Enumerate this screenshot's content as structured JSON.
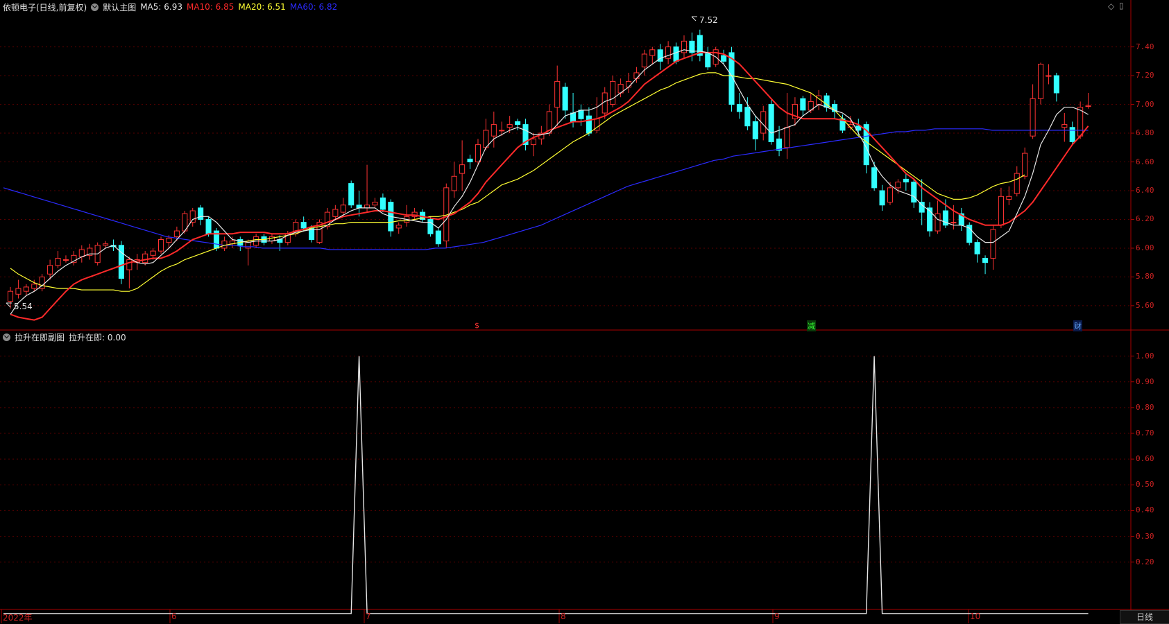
{
  "header": {
    "title": "依顿电子(日线,前复权)",
    "main_chart_name": "默认主图",
    "ma": [
      {
        "label": "MA5: 6.93",
        "color": "#e6e6e6"
      },
      {
        "label": "MA10: 6.85",
        "color": "#ff2a2a"
      },
      {
        "label": "MA20: 6.51",
        "color": "#ffff33"
      },
      {
        "label": "MA60: 6.82",
        "color": "#2b2bff"
      }
    ]
  },
  "sub_header": {
    "name": "拉升在即副图",
    "value_label": "拉升在即: 0.00"
  },
  "markers": {
    "high": "7.52",
    "low": "5.54",
    "m1": "$",
    "m2": "减",
    "m3": "财"
  },
  "price_axis": [
    "7.40",
    "7.20",
    "7.00",
    "6.80",
    "6.60",
    "6.40",
    "6.20",
    "6.00",
    "5.80",
    "5.60"
  ],
  "sub_axis": [
    "1.00",
    "0.90",
    "0.80",
    "0.70",
    "0.60",
    "0.50",
    "0.40",
    "0.30",
    "0.20"
  ],
  "date_axis": [
    "2022年",
    "6",
    "7",
    "8",
    "9",
    "10"
  ],
  "period_button": "日线",
  "colors": {
    "up": "#ff3333",
    "down": "#33ffff",
    "grid": "#5a0000",
    "axis": "#aa0000"
  },
  "chart_data": {
    "type": "line",
    "price_range": [
      5.45,
      7.62
    ],
    "candles": [
      [
        5.63,
        5.7,
        5.58,
        5.73
      ],
      [
        5.68,
        5.72,
        5.65,
        5.78
      ],
      [
        5.7,
        5.73,
        5.67,
        5.75
      ],
      [
        5.72,
        5.75,
        5.7,
        5.78
      ],
      [
        5.72,
        5.8,
        5.7,
        5.82
      ],
      [
        5.82,
        5.88,
        5.78,
        5.92
      ],
      [
        5.88,
        5.93,
        5.86,
        5.98
      ],
      [
        5.92,
        5.92,
        5.9,
        5.95
      ],
      [
        5.9,
        5.95,
        5.88,
        5.98
      ],
      [
        5.94,
        5.99,
        5.9,
        6.02
      ],
      [
        5.95,
        6.0,
        5.92,
        6.03
      ],
      [
        5.9,
        6.02,
        5.88,
        6.04
      ],
      [
        6.02,
        6.03,
        6.0,
        6.05
      ],
      [
        6.02,
        6.01,
        5.98,
        6.06
      ],
      [
        6.02,
        5.79,
        5.75,
        6.05
      ],
      [
        5.85,
        5.92,
        5.72,
        5.94
      ],
      [
        5.9,
        5.92,
        5.85,
        5.96
      ],
      [
        5.9,
        5.96,
        5.88,
        5.98
      ],
      [
        5.95,
        5.98,
        5.92,
        6.0
      ],
      [
        5.98,
        6.06,
        5.96,
        6.08
      ],
      [
        6.04,
        6.07,
        6.0,
        6.09
      ],
      [
        6.08,
        6.12,
        6.05,
        6.15
      ],
      [
        6.12,
        6.24,
        6.1,
        6.26
      ],
      [
        6.18,
        6.26,
        6.15,
        6.28
      ],
      [
        6.28,
        6.2,
        6.16,
        6.3
      ],
      [
        6.2,
        6.1,
        6.08,
        6.22
      ],
      [
        6.12,
        6.0,
        5.98,
        6.14
      ],
      [
        6.0,
        6.05,
        5.98,
        6.08
      ],
      [
        6.03,
        6.05,
        6.0,
        6.08
      ],
      [
        6.06,
        6.02,
        5.98,
        6.08
      ],
      [
        6.0,
        6.04,
        5.88,
        6.06
      ],
      [
        6.02,
        6.08,
        6.0,
        6.1
      ],
      [
        6.08,
        6.04,
        6.02,
        6.1
      ],
      [
        6.05,
        6.08,
        6.03,
        6.1
      ],
      [
        6.06,
        6.04,
        5.98,
        6.09
      ],
      [
        6.04,
        6.1,
        6.02,
        6.12
      ],
      [
        6.1,
        6.18,
        6.08,
        6.2
      ],
      [
        6.18,
        6.14,
        6.12,
        6.22
      ],
      [
        6.14,
        6.06,
        6.04,
        6.16
      ],
      [
        6.04,
        6.18,
        6.03,
        6.2
      ],
      [
        6.15,
        6.25,
        6.13,
        6.28
      ],
      [
        6.22,
        6.27,
        6.2,
        6.3
      ],
      [
        6.25,
        6.3,
        6.23,
        6.35
      ],
      [
        6.45,
        6.3,
        6.28,
        6.47
      ],
      [
        6.3,
        6.28,
        6.22,
        6.4
      ],
      [
        6.28,
        6.3,
        6.25,
        6.58
      ],
      [
        6.3,
        6.32,
        6.28,
        6.35
      ],
      [
        6.35,
        6.27,
        6.25,
        6.38
      ],
      [
        6.32,
        6.12,
        6.08,
        6.34
      ],
      [
        6.14,
        6.16,
        6.1,
        6.18
      ],
      [
        6.18,
        6.22,
        6.15,
        6.3
      ],
      [
        6.22,
        6.25,
        6.2,
        6.28
      ],
      [
        6.25,
        6.2,
        6.18,
        6.27
      ],
      [
        6.2,
        6.1,
        6.08,
        6.22
      ],
      [
        6.12,
        6.03,
        6.01,
        6.14
      ],
      [
        6.05,
        6.42,
        6.0,
        6.45
      ],
      [
        6.4,
        6.5,
        6.35,
        6.6
      ],
      [
        6.52,
        6.58,
        6.4,
        6.75
      ],
      [
        6.62,
        6.6,
        6.55,
        6.65
      ],
      [
        6.6,
        6.72,
        6.58,
        6.76
      ],
      [
        6.7,
        6.82,
        6.68,
        6.9
      ],
      [
        6.78,
        6.86,
        6.7,
        6.95
      ],
      [
        6.82,
        6.82,
        6.78,
        6.88
      ],
      [
        6.84,
        6.86,
        6.8,
        6.92
      ],
      [
        6.88,
        6.86,
        6.82,
        6.9
      ],
      [
        6.86,
        6.72,
        6.68,
        6.9
      ],
      [
        6.72,
        6.76,
        6.64,
        6.8
      ],
      [
        6.76,
        6.8,
        6.72,
        6.85
      ],
      [
        6.8,
        6.95,
        6.78,
        7.0
      ],
      [
        6.98,
        7.16,
        6.85,
        7.27
      ],
      [
        7.12,
        6.96,
        6.9,
        7.15
      ],
      [
        6.94,
        6.88,
        6.84,
        7.08
      ],
      [
        6.96,
        6.9,
        6.85,
        7.0
      ],
      [
        6.92,
        6.8,
        6.78,
        6.98
      ],
      [
        6.82,
        6.9,
        6.8,
        7.05
      ],
      [
        6.94,
        7.08,
        6.9,
        7.12
      ],
      [
        7.0,
        7.16,
        6.98,
        7.2
      ],
      [
        7.08,
        7.14,
        7.05,
        7.18
      ],
      [
        7.12,
        7.16,
        7.08,
        7.22
      ],
      [
        7.18,
        7.22,
        7.15,
        7.26
      ],
      [
        7.26,
        7.35,
        7.2,
        7.38
      ],
      [
        7.34,
        7.38,
        7.28,
        7.4
      ],
      [
        7.38,
        7.3,
        7.24,
        7.42
      ],
      [
        7.32,
        7.4,
        7.28,
        7.44
      ],
      [
        7.4,
        7.3,
        7.28,
        7.43
      ],
      [
        7.36,
        7.44,
        7.32,
        7.48
      ],
      [
        7.44,
        7.36,
        7.3,
        7.5
      ],
      [
        7.48,
        7.34,
        7.3,
        7.52
      ],
      [
        7.36,
        7.26,
        7.24,
        7.4
      ],
      [
        7.28,
        7.38,
        7.26,
        7.4
      ],
      [
        7.34,
        7.3,
        7.28,
        7.38
      ],
      [
        7.36,
        7.0,
        6.95,
        7.4
      ],
      [
        7.0,
        6.95,
        6.9,
        7.08
      ],
      [
        6.98,
        6.85,
        6.82,
        7.05
      ],
      [
        6.88,
        6.76,
        6.68,
        6.92
      ],
      [
        6.8,
        6.95,
        6.75,
        6.99
      ],
      [
        7.0,
        6.74,
        6.72,
        7.03
      ],
      [
        6.76,
        6.68,
        6.64,
        6.85
      ],
      [
        6.7,
        6.84,
        6.62,
        7.08
      ],
      [
        6.9,
        7.0,
        6.85,
        7.05
      ],
      [
        7.04,
        6.96,
        6.92,
        7.06
      ],
      [
        6.96,
        7.02,
        6.94,
        7.08
      ],
      [
        7.0,
        7.06,
        6.96,
        7.1
      ],
      [
        7.06,
        6.98,
        6.95,
        7.08
      ],
      [
        7.0,
        6.95,
        6.9,
        7.03
      ],
      [
        6.9,
        6.82,
        6.8,
        6.93
      ],
      [
        6.84,
        6.86,
        6.82,
        6.92
      ],
      [
        6.85,
        6.82,
        6.78,
        6.9
      ],
      [
        6.86,
        6.58,
        6.52,
        6.88
      ],
      [
        6.56,
        6.42,
        6.4,
        6.6
      ],
      [
        6.4,
        6.3,
        6.26,
        6.44
      ],
      [
        6.32,
        6.42,
        6.3,
        6.46
      ],
      [
        6.42,
        6.46,
        6.38,
        6.48
      ],
      [
        6.48,
        6.46,
        6.4,
        6.52
      ],
      [
        6.46,
        6.32,
        6.28,
        6.48
      ],
      [
        6.32,
        6.25,
        6.16,
        6.48
      ],
      [
        6.28,
        6.12,
        6.08,
        6.32
      ],
      [
        6.12,
        6.24,
        6.1,
        6.33
      ],
      [
        6.26,
        6.16,
        6.14,
        6.34
      ],
      [
        6.18,
        6.18,
        6.13,
        6.3
      ],
      [
        6.24,
        6.16,
        6.12,
        6.28
      ],
      [
        6.16,
        6.04,
        6.02,
        6.18
      ],
      [
        6.04,
        5.96,
        5.9,
        6.06
      ],
      [
        5.93,
        5.9,
        5.82,
        5.95
      ],
      [
        5.93,
        6.13,
        5.85,
        6.16
      ],
      [
        6.16,
        6.36,
        6.14,
        6.42
      ],
      [
        6.34,
        6.36,
        6.3,
        6.43
      ],
      [
        6.38,
        6.52,
        6.36,
        6.57
      ],
      [
        6.5,
        6.66,
        6.48,
        6.7
      ],
      [
        6.78,
        7.04,
        6.76,
        7.14
      ],
      [
        7.04,
        7.28,
        7.0,
        7.29
      ],
      [
        7.2,
        7.2,
        7.14,
        7.28
      ],
      [
        7.2,
        7.08,
        7.02,
        7.22
      ],
      [
        6.84,
        6.86,
        6.74,
        6.94
      ],
      [
        6.84,
        6.74,
        6.72,
        6.88
      ],
      [
        6.78,
        6.98,
        6.76,
        7.02
      ],
      [
        6.99,
        6.99,
        6.97,
        7.08
      ]
    ],
    "ma5": [
      5.54,
      5.62,
      5.67,
      5.7,
      5.74,
      5.79,
      5.84,
      5.88,
      5.91,
      5.94,
      5.96,
      5.96,
      6.0,
      6.02,
      5.97,
      5.93,
      5.9,
      5.89,
      5.9,
      5.95,
      6.0,
      6.06,
      6.12,
      6.2,
      6.22,
      6.22,
      6.18,
      6.12,
      6.06,
      6.05,
      6.04,
      6.05,
      6.05,
      6.05,
      6.06,
      6.09,
      6.11,
      6.12,
      6.13,
      6.13,
      6.16,
      6.2,
      6.23,
      6.26,
      6.28,
      6.28,
      6.28,
      6.24,
      6.22,
      6.21,
      6.2,
      6.19,
      6.18,
      6.18,
      6.14,
      6.2,
      6.29,
      6.36,
      6.46,
      6.58,
      6.7,
      6.76,
      6.79,
      6.82,
      6.84,
      6.82,
      6.79,
      6.79,
      6.8,
      6.86,
      6.92,
      6.94,
      6.96,
      6.96,
      6.98,
      7.02,
      7.04,
      7.08,
      7.12,
      7.18,
      7.24,
      7.28,
      7.32,
      7.34,
      7.36,
      7.38,
      7.37,
      7.37,
      7.36,
      7.33,
      7.28,
      7.2,
      7.1,
      7.0,
      6.92,
      6.86,
      6.8,
      6.82,
      6.84,
      6.86,
      6.92,
      6.96,
      7.0,
      6.98,
      6.96,
      6.94,
      6.9,
      6.8,
      6.7,
      6.58,
      6.5,
      6.44,
      6.4,
      6.38,
      6.36,
      6.3,
      6.26,
      6.2,
      6.18,
      6.16,
      6.16,
      6.14,
      6.08,
      6.04,
      6.04,
      6.08,
      6.12,
      6.24,
      6.36,
      6.52,
      6.72,
      6.82,
      6.93,
      6.98,
      6.98,
      6.96,
      6.93
    ],
    "ma10": [
      5.54,
      5.52,
      5.51,
      5.5,
      5.52,
      5.58,
      5.64,
      5.7,
      5.75,
      5.78,
      5.8,
      5.82,
      5.84,
      5.86,
      5.88,
      5.9,
      5.91,
      5.92,
      5.93,
      5.93,
      5.95,
      5.98,
      6.02,
      6.06,
      6.08,
      6.1,
      6.1,
      6.1,
      6.1,
      6.11,
      6.11,
      6.11,
      6.11,
      6.1,
      6.1,
      6.1,
      6.12,
      6.13,
      6.15,
      6.16,
      6.18,
      6.2,
      6.22,
      6.23,
      6.24,
      6.25,
      6.26,
      6.26,
      6.25,
      6.24,
      6.23,
      6.23,
      6.22,
      6.21,
      6.2,
      6.22,
      6.24,
      6.28,
      6.32,
      6.38,
      6.46,
      6.52,
      6.58,
      6.64,
      6.7,
      6.74,
      6.77,
      6.79,
      6.82,
      6.84,
      6.86,
      6.88,
      6.88,
      6.89,
      6.9,
      6.92,
      6.95,
      6.98,
      7.02,
      7.08,
      7.14,
      7.18,
      7.22,
      7.26,
      7.3,
      7.32,
      7.34,
      7.36,
      7.36,
      7.36,
      7.35,
      7.32,
      7.28,
      7.22,
      7.16,
      7.1,
      7.04,
      6.98,
      6.94,
      6.92,
      6.9,
      6.9,
      6.9,
      6.9,
      6.9,
      6.89,
      6.88,
      6.86,
      6.82,
      6.76,
      6.7,
      6.64,
      6.58,
      6.52,
      6.48,
      6.42,
      6.38,
      6.34,
      6.3,
      6.26,
      6.23,
      6.2,
      6.18,
      6.16,
      6.16,
      6.16,
      6.18,
      6.22,
      6.26,
      6.32,
      6.4,
      6.48,
      6.56,
      6.64,
      6.72,
      6.78,
      6.85
    ],
    "ma20": [
      5.86,
      5.82,
      5.79,
      5.76,
      5.74,
      5.73,
      5.72,
      5.72,
      5.72,
      5.71,
      5.71,
      5.71,
      5.71,
      5.71,
      5.7,
      5.7,
      5.72,
      5.76,
      5.8,
      5.84,
      5.87,
      5.89,
      5.92,
      5.94,
      5.96,
      5.98,
      6.0,
      6.02,
      6.03,
      6.04,
      6.05,
      6.06,
      6.06,
      6.07,
      6.08,
      6.09,
      6.1,
      6.12,
      6.14,
      6.15,
      6.16,
      6.17,
      6.17,
      6.18,
      6.18,
      6.18,
      6.18,
      6.18,
      6.18,
      6.19,
      6.19,
      6.2,
      6.21,
      6.22,
      6.22,
      6.23,
      6.25,
      6.27,
      6.3,
      6.32,
      6.36,
      6.4,
      6.44,
      6.46,
      6.48,
      6.51,
      6.54,
      6.58,
      6.62,
      6.66,
      6.7,
      6.74,
      6.77,
      6.8,
      6.84,
      6.88,
      6.92,
      6.95,
      6.98,
      7.01,
      7.04,
      7.07,
      7.1,
      7.12,
      7.15,
      7.17,
      7.19,
      7.21,
      7.22,
      7.22,
      7.2,
      7.2,
      7.19,
      7.18,
      7.18,
      7.17,
      7.16,
      7.15,
      7.14,
      7.12,
      7.1,
      7.08,
      7.04,
      7.0,
      6.96,
      6.9,
      6.84,
      6.78,
      6.74,
      6.7,
      6.66,
      6.62,
      6.58,
      6.54,
      6.5,
      6.46,
      6.42,
      6.38,
      6.36,
      6.34,
      6.34,
      6.35,
      6.37,
      6.4,
      6.43,
      6.45,
      6.46,
      6.48,
      6.51
    ],
    "ma60": [
      6.42,
      6.4,
      6.38,
      6.36,
      6.34,
      6.32,
      6.3,
      6.28,
      6.26,
      6.24,
      6.22,
      6.2,
      6.18,
      6.16,
      6.14,
      6.12,
      6.1,
      6.08,
      6.07,
      6.06,
      6.05,
      6.04,
      6.03,
      6.02,
      6.02,
      6.01,
      6.01,
      6.0,
      6.0,
      6.0,
      6.0,
      6.0,
      6.0,
      6.0,
      5.99,
      5.99,
      5.99,
      5.99,
      5.99,
      5.99,
      5.99,
      5.99,
      5.99,
      5.99,
      5.99,
      6.0,
      6.0,
      6.01,
      6.02,
      6.03,
      6.04,
      6.06,
      6.08,
      6.1,
      6.12,
      6.14,
      6.16,
      6.19,
      6.22,
      6.25,
      6.28,
      6.31,
      6.34,
      6.37,
      6.4,
      6.43,
      6.45,
      6.47,
      6.49,
      6.51,
      6.53,
      6.55,
      6.57,
      6.59,
      6.61,
      6.62,
      6.64,
      6.65,
      6.66,
      6.67,
      6.68,
      6.69,
      6.7,
      6.71,
      6.72,
      6.73,
      6.74,
      6.75,
      6.76,
      6.77,
      6.78,
      6.79,
      6.8,
      6.81,
      6.81,
      6.82,
      6.82,
      6.83,
      6.83,
      6.83,
      6.83,
      6.83,
      6.83,
      6.82,
      6.82,
      6.82,
      6.82,
      6.82,
      6.82,
      6.82,
      6.82,
      6.82,
      6.82,
      6.82
    ],
    "sub_indicator": {
      "name": "拉升在即",
      "range": [
        0,
        1.05
      ],
      "spike_indices": [
        44,
        109
      ],
      "values_default": 0
    }
  }
}
